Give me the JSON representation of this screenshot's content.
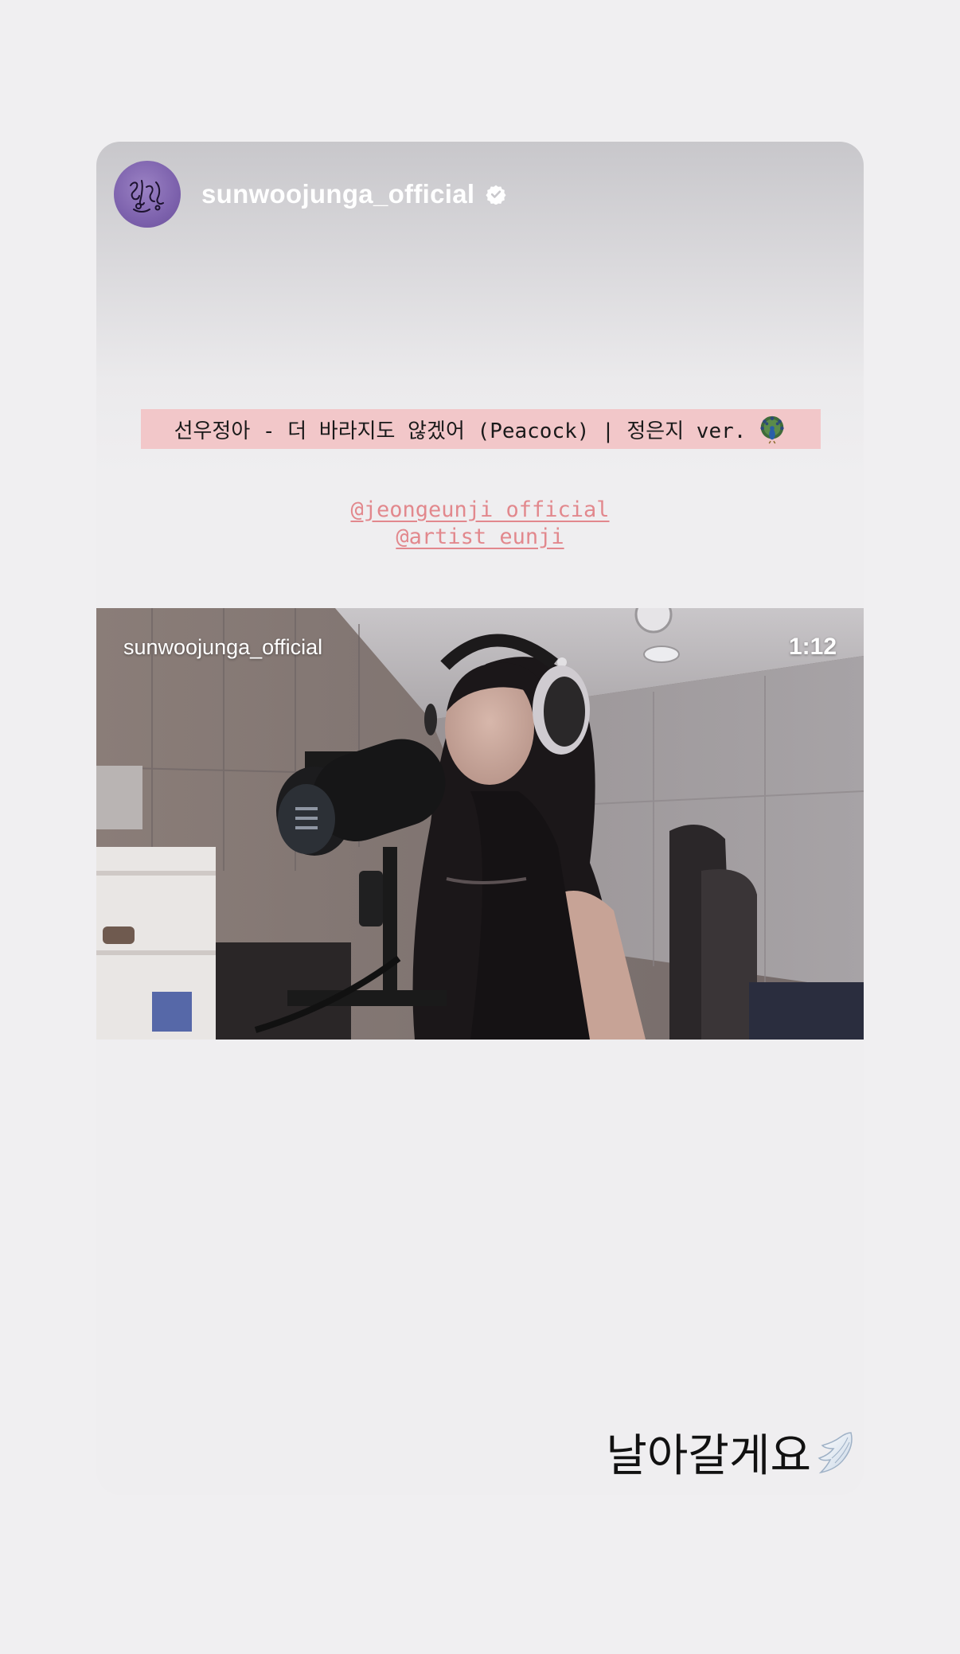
{
  "story": {
    "username": "sunwoojunga_official",
    "song_title": "선우정아 - 더 바라지도 않겠어 (Peacock) | 정은지 ver.",
    "title_emoji": "peacock-icon",
    "mentions": [
      "@jeongeunji_official",
      "@artist_eunji"
    ],
    "video": {
      "username": "sunwoojunga_official",
      "duration": "1:12"
    },
    "caption": "날아갈게요",
    "caption_emoji": "wing-icon"
  },
  "colors": {
    "background": "#f0eff1",
    "title_highlight": "#f2c7c9",
    "mention": "#e2888d",
    "avatar": "#7d62ad"
  }
}
